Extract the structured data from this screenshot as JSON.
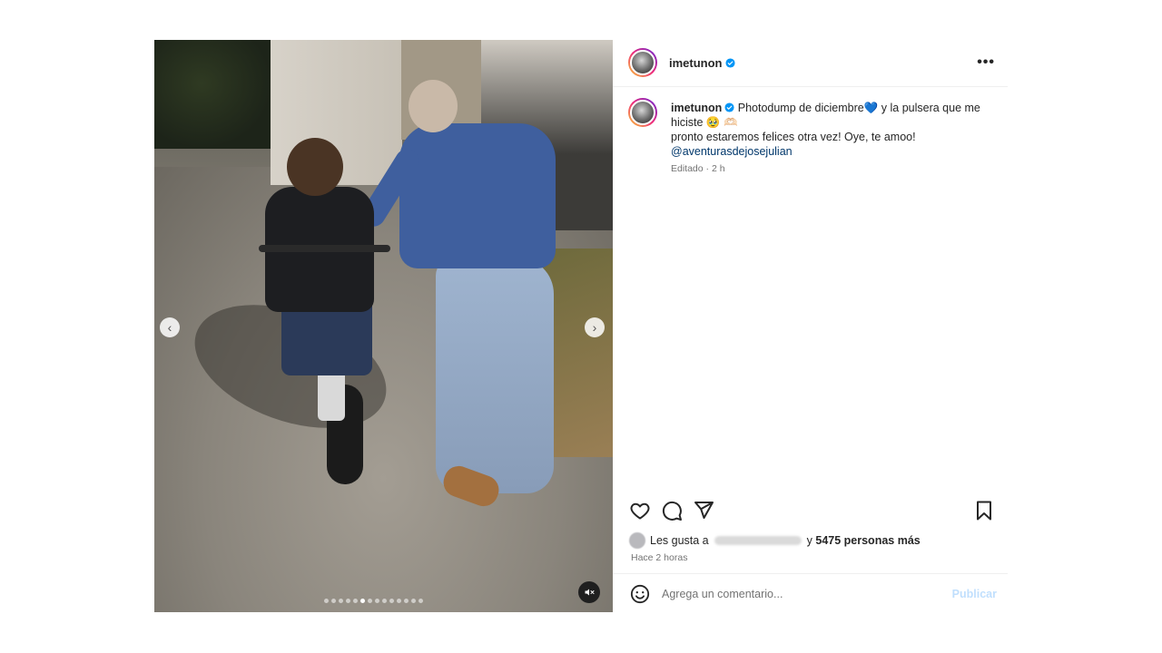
{
  "post": {
    "username": "imetunon",
    "verified": true,
    "more_menu_label": "•••",
    "caption": {
      "username": "imetunon",
      "text_part1": "Photodump de diciembre",
      "emoji_heart": "💙",
      "text_part2": " y la pulsera que me hiciste",
      "emoji_face": "🥹",
      "emoji_hands": "🫶🏻",
      "text_line2": "pronto estaremos felices otra vez! Oye, te amoo!",
      "mention": "@aventurasdejosejulian"
    },
    "meta": "Editado · 2 h",
    "likes": {
      "prefix": "Les gusta a",
      "suffix": "y",
      "count_text": "5475 personas más"
    },
    "time_ago": "Hace 2 horas"
  },
  "media": {
    "carousel_count": 14,
    "active_index": 5,
    "prev_label": "‹",
    "next_label": "›"
  },
  "comment": {
    "placeholder": "Agrega un comentario...",
    "publish_label": "Publicar"
  },
  "colors": {
    "verified_blue": "#0095f6",
    "mention": "#00376b",
    "publish_disabled": "#c0dffd"
  }
}
